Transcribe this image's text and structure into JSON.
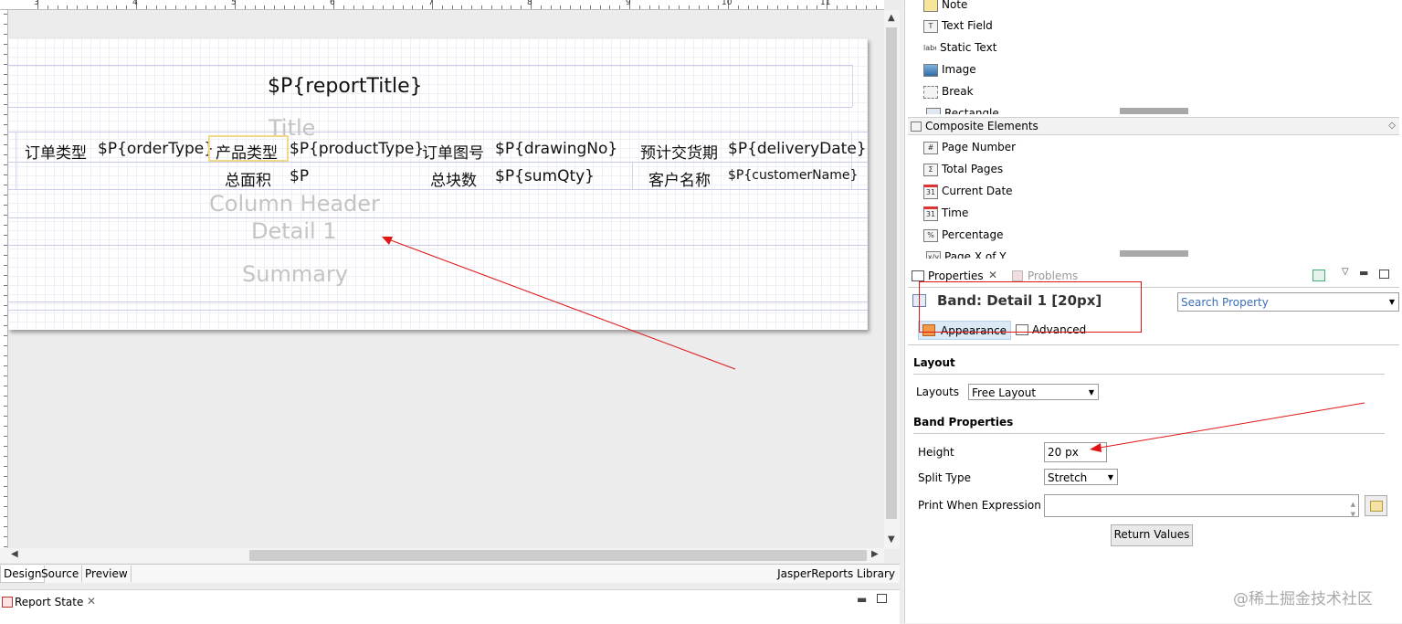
{
  "editor": {
    "ruler_numbers": [
      "3",
      "4",
      "5",
      "6",
      "7",
      "8",
      "9",
      "10",
      "11"
    ],
    "report": {
      "title_field": "$P{reportTitle}",
      "band_labels": {
        "title": "Title",
        "column_header": "Column Header",
        "detail": "Detail 1",
        "summary": "Summary"
      },
      "row1": [
        "订单类型",
        "$P{orderType}",
        "产品类型",
        "$P{productType}",
        "订单图号",
        "$P{drawingNo}",
        "预计交货期",
        "$P{deliveryDate}"
      ],
      "row2": [
        "总面积",
        "$P",
        "总块数",
        "$P{sumQty}",
        "客户名称",
        "$P{customerName}"
      ]
    },
    "tabs": [
      "Design",
      "Source",
      "Preview"
    ],
    "library_label": "JasperReports Library",
    "report_state_label": "Report State"
  },
  "palette": {
    "basic_items": [
      {
        "label": "Note",
        "icon": "note-icon"
      },
      {
        "label": "Text Field",
        "icon": "text-field-icon"
      },
      {
        "label": "Static Text",
        "icon": "static-text-icon"
      },
      {
        "label": "Image",
        "icon": "image-icon"
      },
      {
        "label": "Break",
        "icon": "break-icon"
      },
      {
        "label": "Rectangle",
        "icon": "rectangle-icon"
      }
    ],
    "composite_header": "Composite Elements",
    "composite_items": [
      {
        "label": "Page Number",
        "icon": "page-number-icon"
      },
      {
        "label": "Total Pages",
        "icon": "total-pages-icon"
      },
      {
        "label": "Current Date",
        "icon": "calendar-icon"
      },
      {
        "label": "Time",
        "icon": "time-icon"
      },
      {
        "label": "Percentage",
        "icon": "percentage-icon"
      },
      {
        "label": "Page X of Y",
        "icon": "page-x-of-y-icon"
      }
    ]
  },
  "properties": {
    "tab_properties": "Properties",
    "tab_problems": "Problems",
    "band_title": "Band: Detail 1 [20px]",
    "search_placeholder": "Search Property",
    "subtab_appearance": "Appearance",
    "subtab_advanced": "Advanced",
    "layout_section": "Layout",
    "layouts_label": "Layouts",
    "layouts_value": "Free Layout",
    "band_section": "Band Properties",
    "height_label": "Height",
    "height_value": "20 px",
    "split_label": "Split Type",
    "split_value": "Stretch",
    "print_when_label": "Print When Expression",
    "print_when_value": "",
    "return_values_button": "Return Values"
  },
  "watermark": "@稀土掘金技术社区",
  "colors": {
    "annotation_red": "#e01515",
    "band_highlight": "#f0d98a"
  }
}
